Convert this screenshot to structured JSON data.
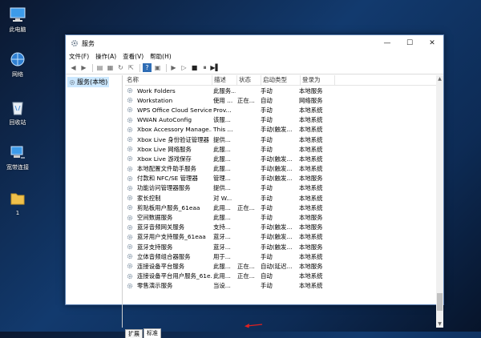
{
  "desktop": {
    "icons": [
      {
        "label": "此电脑",
        "icon": "computer-icon"
      },
      {
        "label": "网络",
        "icon": "network-icon"
      },
      {
        "label": "回收站",
        "icon": "recycle-bin-icon"
      },
      {
        "label": "宽带连接",
        "icon": "broadband-icon"
      },
      {
        "label": "1",
        "icon": "folder-icon"
      }
    ]
  },
  "window": {
    "title": "服务",
    "controls": {
      "minimize": "—",
      "maximize": "☐",
      "close": "✕"
    }
  },
  "menu": [
    "文件(F)",
    "操作(A)",
    "查看(V)",
    "帮助(H)"
  ],
  "tree": {
    "root": "服务(本地)"
  },
  "columns": [
    "名称",
    "描述",
    "状态",
    "启动类型",
    "登录为"
  ],
  "services": [
    {
      "name": "Work Folders",
      "desc": "此服务...",
      "status": "",
      "startup": "手动",
      "logon": "本地服务"
    },
    {
      "name": "Workstation",
      "desc": "使用 ...",
      "status": "正在...",
      "startup": "自动",
      "logon": "网络服务"
    },
    {
      "name": "WPS Office Cloud Service",
      "desc": "Prov...",
      "status": "",
      "startup": "手动",
      "logon": "本地系统"
    },
    {
      "name": "WWAN AutoConfig",
      "desc": "该服...",
      "status": "",
      "startup": "手动",
      "logon": "本地系统"
    },
    {
      "name": "Xbox Accessory Manage...",
      "desc": "This ...",
      "status": "",
      "startup": "手动(触发...",
      "logon": "本地系统"
    },
    {
      "name": "Xbox Live 身份验证管理器",
      "desc": "提供...",
      "status": "",
      "startup": "手动",
      "logon": "本地系统"
    },
    {
      "name": "Xbox Live 网络服务",
      "desc": "此服...",
      "status": "",
      "startup": "手动",
      "logon": "本地系统"
    },
    {
      "name": "Xbox Live 游戏保存",
      "desc": "此服...",
      "status": "",
      "startup": "手动(触发...",
      "logon": "本地系统"
    },
    {
      "name": "本地配置文件助手服务",
      "desc": "此服...",
      "status": "",
      "startup": "手动(触发...",
      "logon": "本地系统"
    },
    {
      "name": "付款和 NFC/SE 管理器",
      "desc": "管理...",
      "status": "",
      "startup": "手动(触发...",
      "logon": "本地服务"
    },
    {
      "name": "功能访问管理器服务",
      "desc": "提供...",
      "status": "",
      "startup": "手动",
      "logon": "本地系统"
    },
    {
      "name": "家长控制",
      "desc": "对 W...",
      "status": "",
      "startup": "手动",
      "logon": "本地系统"
    },
    {
      "name": "剪贴板用户服务_61eaa",
      "desc": "此用...",
      "status": "正在...",
      "startup": "手动",
      "logon": "本地系统"
    },
    {
      "name": "空间数据服务",
      "desc": "此服...",
      "status": "",
      "startup": "手动",
      "logon": "本地服务"
    },
    {
      "name": "蓝牙音频网关服务",
      "desc": "支持...",
      "status": "",
      "startup": "手动(触发...",
      "logon": "本地服务"
    },
    {
      "name": "蓝牙用户支持服务_61eaa",
      "desc": "蓝牙...",
      "status": "",
      "startup": "手动(触发...",
      "logon": "本地系统"
    },
    {
      "name": "蓝牙支持服务",
      "desc": "蓝牙...",
      "status": "",
      "startup": "手动(触发...",
      "logon": "本地服务"
    },
    {
      "name": "立体音频组合器服务",
      "desc": "用于...",
      "status": "",
      "startup": "手动",
      "logon": "本地系统"
    },
    {
      "name": "连接设备平台服务",
      "desc": "此服...",
      "status": "正在...",
      "startup": "自动(延迟...",
      "logon": "本地服务"
    },
    {
      "name": "连接设备平台用户服务_61e...",
      "desc": "此用...",
      "status": "正在...",
      "startup": "自动",
      "logon": "本地系统"
    },
    {
      "name": "零售演示服务",
      "desc": "当设...",
      "status": "",
      "startup": "手动",
      "logon": "本地系统"
    }
  ],
  "tabs": [
    "扩展",
    "标准"
  ],
  "scrollbar": {
    "position": 0.92
  },
  "colors": {
    "accent": "#cce8ff",
    "arrow": "#e02020"
  }
}
